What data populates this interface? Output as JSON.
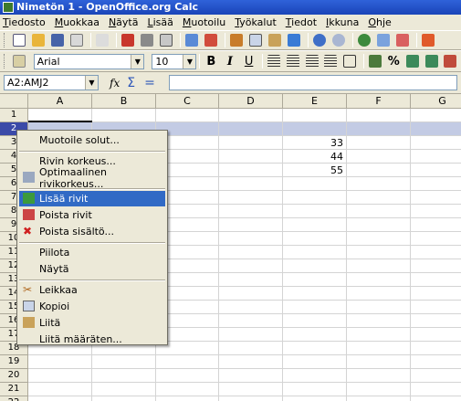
{
  "window": {
    "title": "Nimetön 1 - OpenOffice.org Calc"
  },
  "menubar": [
    "Tiedosto",
    "Muokkaa",
    "Näytä",
    "Lisää",
    "Muotoilu",
    "Työkalut",
    "Tiedot",
    "Ikkuna",
    "Ohje"
  ],
  "toolbar": {
    "font_name": "Arial",
    "font_size": "10",
    "bold": "B",
    "italic": "I",
    "underline": "U",
    "percent": "%"
  },
  "formula": {
    "name_box": "A2:AMJ2",
    "fx": "fx",
    "sigma": "Σ",
    "equals": "="
  },
  "columns": [
    "A",
    "B",
    "C",
    "D",
    "E",
    "F",
    "G"
  ],
  "rows": [
    "1",
    "2",
    "3",
    "4",
    "5",
    "6",
    "7",
    "8",
    "9",
    "10",
    "11",
    "12",
    "13",
    "14",
    "15",
    "16",
    "17",
    "18",
    "19",
    "20",
    "21",
    "22"
  ],
  "cells": {
    "E3": "33",
    "E4": "44",
    "E5": "55"
  },
  "context_menu": {
    "items": [
      "Muotoile solut...",
      "Rivin korkeus...",
      "Optimaalinen rivikorkeus...",
      "Lisää rivit",
      "Poista rivit",
      "Poista sisältö...",
      "Piilota",
      "Näytä",
      "Leikkaa",
      "Kopioi",
      "Liitä",
      "Liitä määräten..."
    ],
    "highlighted": "Lisää rivit"
  }
}
